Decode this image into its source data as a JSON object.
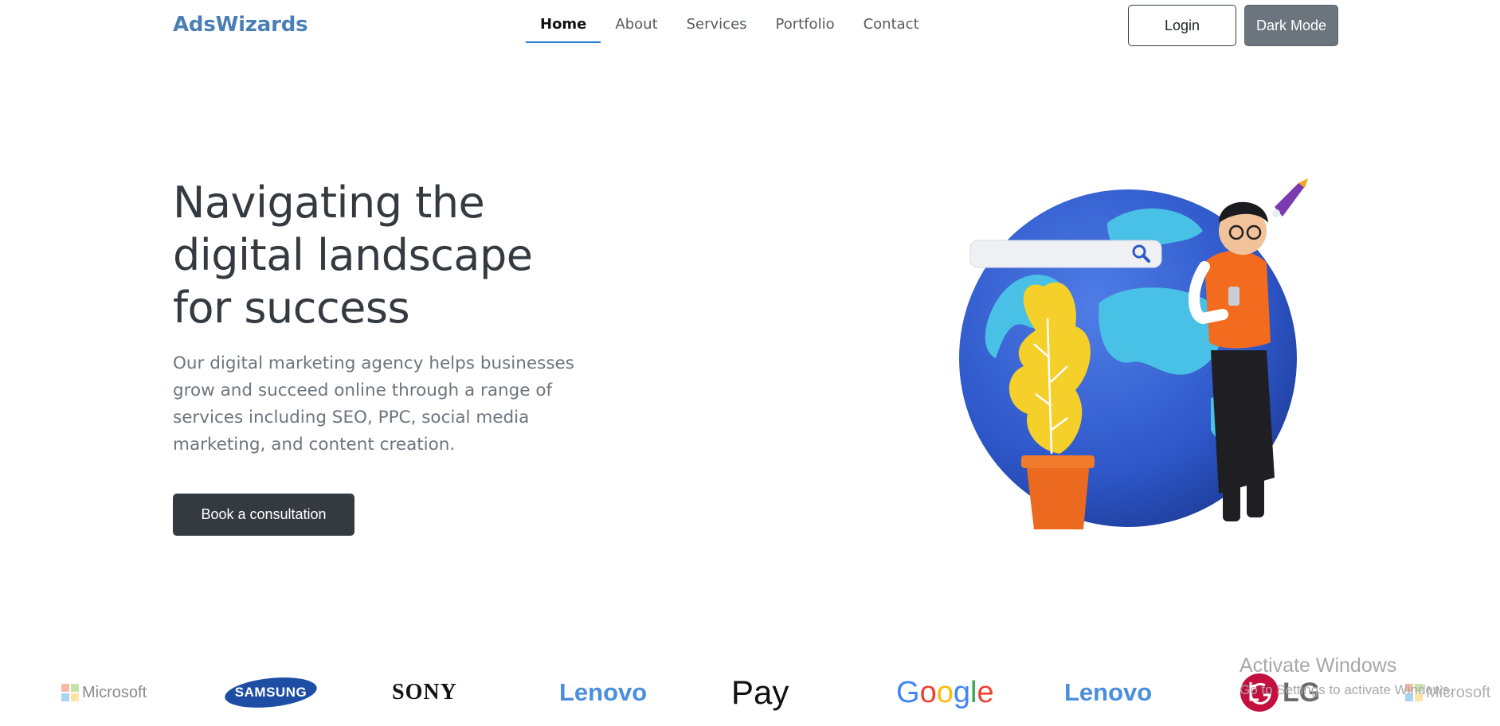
{
  "navbar": {
    "brand": "AdsWizards",
    "items": [
      {
        "label": "Home",
        "active": true
      },
      {
        "label": "About",
        "active": false
      },
      {
        "label": "Services",
        "active": false
      },
      {
        "label": "Portfolio",
        "active": false
      },
      {
        "label": "Contact",
        "active": false
      }
    ],
    "login_label": "Login",
    "dark_mode_label": "Dark Mode"
  },
  "hero": {
    "title_lines": [
      "Navigating the",
      "digital landscape",
      "for success"
    ],
    "description": "Our digital marketing agency helps businesses grow and succeed online through a range of services including SEO, PPC, social media marketing, and content creation.",
    "cta_label": "Book a consultation",
    "search_icon": "search-icon"
  },
  "logos": [
    "Microsoft",
    "SAMSUNG",
    "SONY",
    "Lenovo",
    "Pay",
    "Google",
    "Lenovo",
    "LG",
    "Microsoft"
  ],
  "watermark": {
    "title": "Activate Windows",
    "subtitle": "Go to Settings to activate Windows."
  },
  "colors": {
    "brand": "#4a7fb5",
    "active_underline": "#2b7fd3",
    "dark_button": "#343a40",
    "dark_mode_button": "#6c757d"
  }
}
